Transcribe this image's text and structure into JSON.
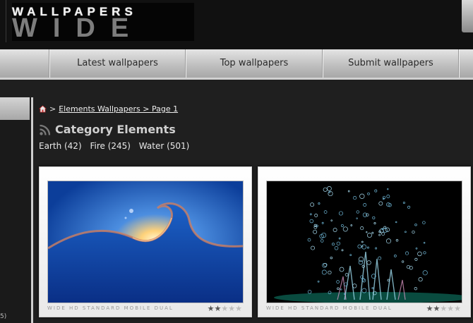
{
  "header": {
    "logo_top": "WALLPAPERS",
    "logo_bottom": "WIDE"
  },
  "nav": [
    {
      "label": "Latest wallpapers"
    },
    {
      "label": "Top wallpapers"
    },
    {
      "label": "Submit wallpapers"
    }
  ],
  "sidebar": {
    "tail_text": "5)"
  },
  "breadcrumb": {
    "link": "Elements Wallpapers > Page 1",
    "separator": ">"
  },
  "category": {
    "title": "Category Elements",
    "subcategories": [
      {
        "label": "Earth (42)"
      },
      {
        "label": "Fire (245)"
      },
      {
        "label": "Water (501)"
      }
    ]
  },
  "thumbnails": [
    {
      "formats": "WIDE HD STANDARD MOBILE DUAL",
      "rating": 2
    },
    {
      "formats": "WIDE HD STANDARD MOBILE DUAL",
      "rating": 2
    }
  ],
  "colors": {
    "background": "#1f1f1f",
    "nav": "#c8c8c8",
    "water_blue": "#1f5fbf"
  }
}
